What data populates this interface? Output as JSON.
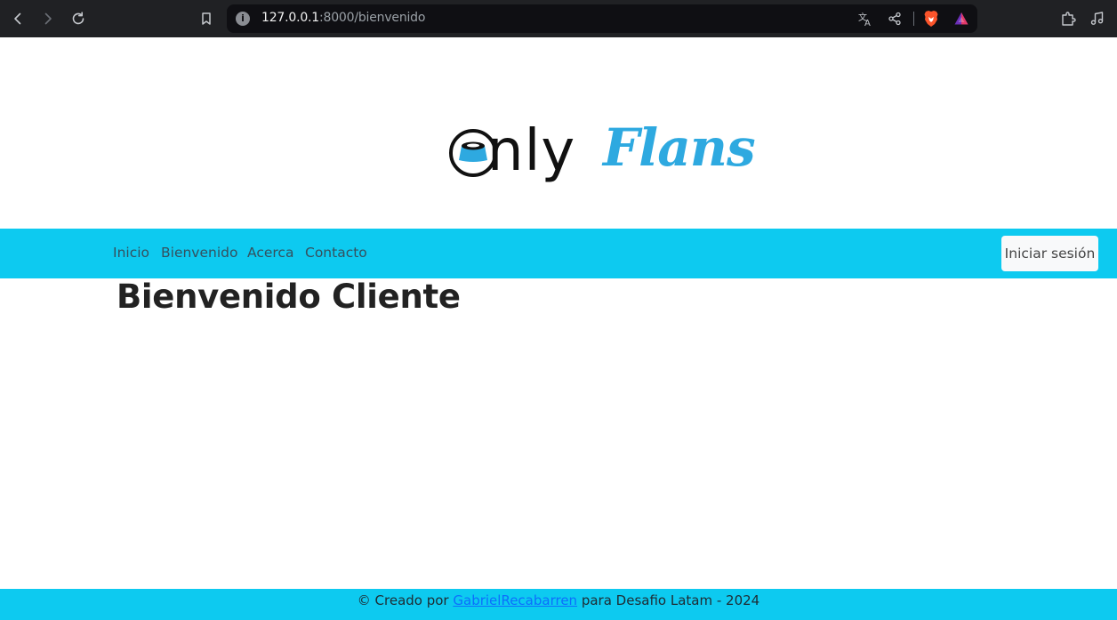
{
  "browser": {
    "url_host": "127.0.0.1",
    "url_path": ":8000/bienvenido",
    "site_info_glyph": "i",
    "icons": [
      "back-arrow-icon",
      "forward-arrow-icon",
      "reload-icon",
      "bookmark-icon",
      "site-info-icon",
      "translate-icon",
      "share-icon",
      "brave-shields-icon",
      "brave-rewards-icon",
      "extensions-icon",
      "media-icon"
    ]
  },
  "logo": {
    "text_only": "nly",
    "text_flans": "Flans",
    "flan_color": "#2ea9e0"
  },
  "nav": {
    "items": [
      {
        "label": "Inicio"
      },
      {
        "label": "Bienvenido"
      },
      {
        "label": "Acerca"
      },
      {
        "label": "Contacto"
      }
    ],
    "login_label": "Iniciar sesión"
  },
  "main": {
    "title": "Bienvenido Cliente"
  },
  "footer": {
    "prefix": "© Creado por ",
    "author": "GabrielRecabarren",
    "suffix": " para Desafio Latam - 2024"
  },
  "colors": {
    "accent": "#0dcaf0",
    "link": "#0d6efd",
    "chrome": "#202124"
  }
}
